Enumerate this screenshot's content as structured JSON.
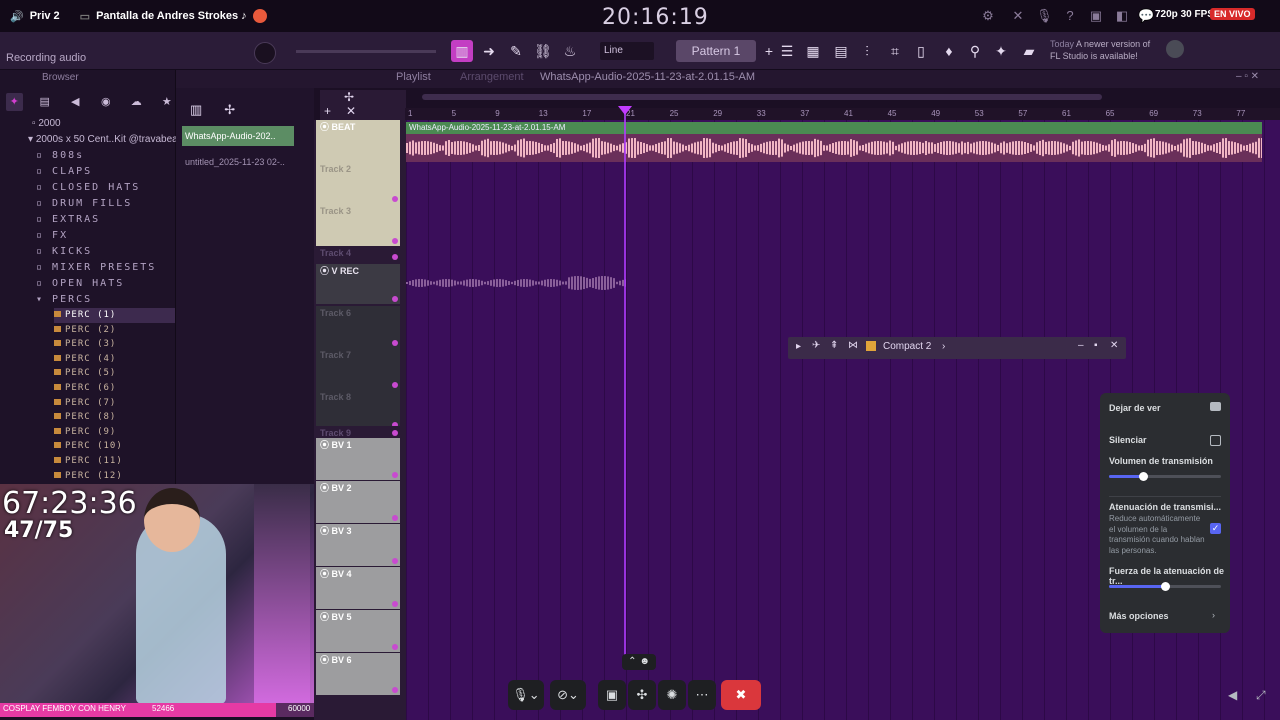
{
  "topbar": {
    "channel": "Priv 2",
    "stream_title": "Pantalla de Andres Strokes ♪",
    "clock": "20:16:19",
    "fps": "720p 30 FPS",
    "live": "EN VIVO"
  },
  "fl": {
    "recording_hint": "Recording audio",
    "line_mode": "Line",
    "pattern": "Pattern 1",
    "update_hint_day": "Today",
    "update_hint_text": "A newer version of",
    "update_hint_text2": "FL Studio is available!",
    "playlist_title": "Playlist",
    "playlist_sub": "Arrangement",
    "playlist_file": "WhatsApp-Audio-2025-11-23-at-2.01.15-AM"
  },
  "browser": {
    "title": "Browser",
    "folders": [
      "2000",
      "2000s x 50 Cent..Kit @travabeats"
    ],
    "subfolders": [
      "808s",
      "CLAPS",
      "CLOSED HATS",
      "DRUM FILLS",
      "EXTRAS",
      "FX",
      "KICKS",
      "MIXER PRESETS",
      "OPEN HATS",
      "PERCS"
    ],
    "percs": [
      "PERC (1)",
      "PERC (2)",
      "PERC (3)",
      "PERC (4)",
      "PERC (5)",
      "PERC (6)",
      "PERC (7)",
      "PERC (8)",
      "PERC (9)",
      "PERC (10)",
      "PERC (11)",
      "PERC (12)"
    ]
  },
  "channels": [
    "WhatsApp-Audio-202..",
    "untitled_2025-11-23 02-.."
  ],
  "ruler": [
    "1",
    "5",
    "9",
    "13",
    "17",
    "21",
    "25",
    "29",
    "33",
    "37",
    "41",
    "45",
    "49",
    "53",
    "57",
    "61",
    "65",
    "69",
    "73",
    "77"
  ],
  "tracks": [
    {
      "name": "BEAT",
      "top": 0
    },
    {
      "name": "Track 2",
      "top": 0
    },
    {
      "name": "Track 3",
      "top": 0
    },
    {
      "name": "Track 4",
      "top": 0
    },
    {
      "name": "V REC",
      "top": 0
    },
    {
      "name": "Track 6",
      "top": 0
    },
    {
      "name": "Track 7",
      "top": 0
    },
    {
      "name": "Track 8",
      "top": 0
    },
    {
      "name": "Track 9",
      "top": 0
    },
    {
      "name": "BV 1",
      "top": 0
    },
    {
      "name": "BV 2",
      "top": 0
    },
    {
      "name": "BV 3",
      "top": 0
    },
    {
      "name": "BV 4",
      "top": 0
    },
    {
      "name": "BV 5",
      "top": 0
    },
    {
      "name": "BV 6",
      "top": 0
    }
  ],
  "clip_label": "WhatsApp-Audio-2025-11-23-at-2.01.15-AM",
  "compact": {
    "title": "Compact 2"
  },
  "stream": {
    "timer": "67:23:36",
    "count": "47/75",
    "bottom_left": "COSPLAY FEMBOY CON HENRY",
    "bottom_mid": "52466",
    "bottom_right": "60000"
  },
  "dpanel": {
    "stop_watching": "Dejar de ver",
    "mute": "Silenciar",
    "volume_label": "Volumen de transmisión",
    "volume_level": 0.3,
    "attenuation_title": "Atenuación de transmisi...",
    "attenuation_desc": "Reduce automáticamente el volumen de la transmisión cuando hablan las personas.",
    "attenuation_enabled": true,
    "strength_label": "Fuerza de la atenuación de tr...",
    "strength_level": 0.5,
    "more_options": "Más opciones"
  }
}
